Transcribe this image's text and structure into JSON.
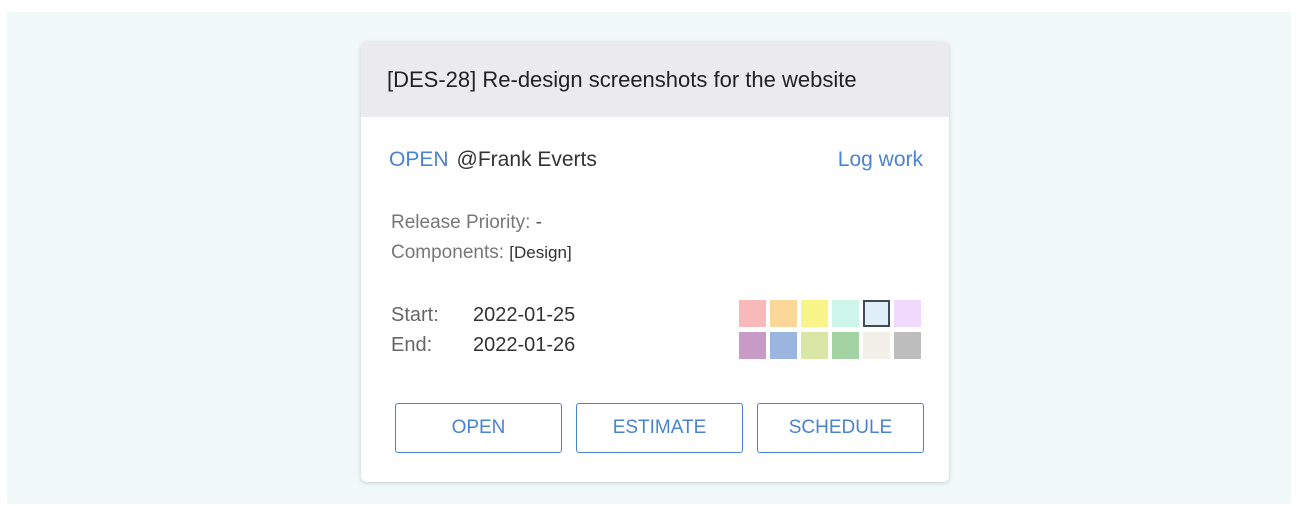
{
  "card": {
    "title": "[DES-28] Re-design screenshots for the website",
    "status": "OPEN",
    "assignee": "@Frank Everts",
    "log_work_label": "Log work",
    "release_priority_label": "Release Priority:",
    "release_priority_value": "-",
    "components_label": "Components:",
    "components_value": "[Design]",
    "start_label": "Start:",
    "start_value": "2022-01-25",
    "end_label": "End:",
    "end_value": "2022-01-26",
    "colors": [
      "#f9b9b9",
      "#fcd79a",
      "#f7f58a",
      "#cdf5ea",
      "#dfeef7",
      "#f0d9fb",
      "#c89bc6",
      "#9bb6de",
      "#dae6a6",
      "#a3d3a3",
      "#f3f0ea",
      "#bdbdbd"
    ],
    "selected_color_index": 4,
    "buttons": {
      "open": "OPEN",
      "estimate": "ESTIMATE",
      "schedule": "SCHEDULE"
    },
    "accent_color": "#4a82d4"
  }
}
